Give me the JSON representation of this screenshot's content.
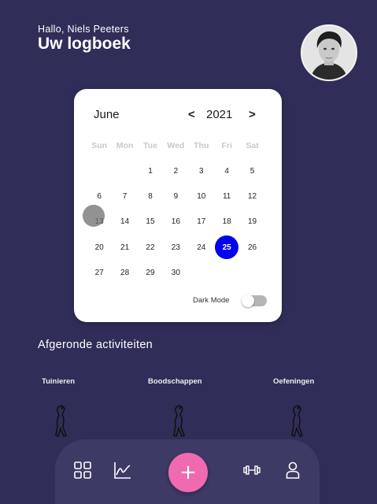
{
  "header": {
    "greeting": "Hallo, Niels Peeters",
    "title": "Uw logboek"
  },
  "calendar": {
    "month": "June",
    "year": "2021",
    "prev_label": "<",
    "next_label": ">",
    "weekdays": [
      "Sun",
      "Mon",
      "Tue",
      "Wed",
      "Thu",
      "Fri",
      "Sat"
    ],
    "leading_blanks": 2,
    "days": [
      "1",
      "2",
      "3",
      "4",
      "5",
      "6",
      "7",
      "8",
      "9",
      "10",
      "11",
      "12",
      "13",
      "14",
      "15",
      "16",
      "17",
      "18",
      "19",
      "20",
      "21",
      "22",
      "23",
      "24",
      "25",
      "26",
      "27",
      "28",
      "29",
      "30"
    ],
    "selected_day": "25",
    "selected_color": "#0000ee",
    "dark_mode_label": "Dark Mode",
    "dark_mode_on": false
  },
  "activities": {
    "title": "Afgeronde activiteiten",
    "items": [
      {
        "label": "Tuinieren",
        "icon": "stretching-person-icon"
      },
      {
        "label": "Boodschappen",
        "icon": "stretching-person-icon"
      },
      {
        "label": "Oefeningen",
        "icon": "stretching-person-icon"
      }
    ]
  },
  "nav": {
    "items": [
      "dashboard-icon",
      "chart-icon",
      "add-icon",
      "dumbbell-icon",
      "user-icon"
    ],
    "fab_label": "+",
    "fab_color": "#f06ab0"
  },
  "colors": {
    "background": "#302d59",
    "bottom_bar": "#3d3a66"
  }
}
